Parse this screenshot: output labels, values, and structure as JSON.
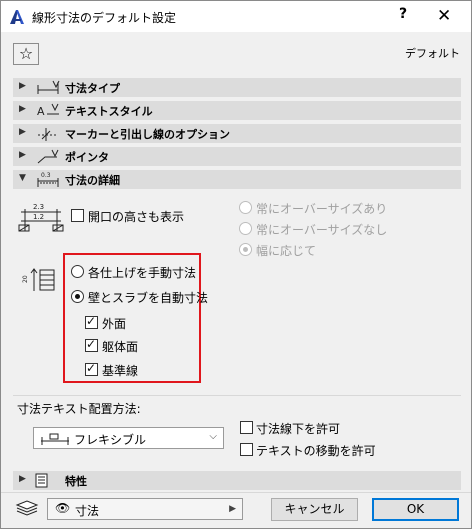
{
  "window": {
    "title": "線形寸法のデフォルト設定",
    "help_label": "?",
    "close_label": "✕"
  },
  "header": {
    "favorite_icon": "☆",
    "default_label": "デフォルト"
  },
  "sections": {
    "dim_type": "寸法タイプ",
    "text_style": "テキストスタイル",
    "marker": "マーカーと引出し線のオプション",
    "pointer": "ポインタ",
    "dim_detail": "寸法の詳細",
    "properties": "特性"
  },
  "details": {
    "icon_top_text": "2.3",
    "icon_bottom_text": "1.2",
    "icon_side_text": "20",
    "show_opening_height": "開口の高さも表示",
    "show_opening_height_checked": false,
    "oversize_options": [
      {
        "label": "常にオーバーサイズあり",
        "checked": false
      },
      {
        "label": "常にオーバーサイズなし",
        "checked": false
      },
      {
        "label": "幅に応じて",
        "checked": true
      }
    ],
    "finish_manual": "各仕上げを手動寸法",
    "wall_slab_auto": "壁とスラブを自動寸法",
    "outer_face": "外面",
    "core_face": "躯体面",
    "reference_line": "基準線"
  },
  "placement": {
    "heading": "寸法テキスト配置方法:",
    "selected": "フレキシブル",
    "allow_below": "寸法線下を許可",
    "allow_move": "テキストの移動を許可"
  },
  "footer": {
    "layer_value": "寸法",
    "cancel_label": "キャンセル",
    "ok_label": "OK"
  },
  "colors": {
    "highlight_border": "#e0161c",
    "section_bar": "#dcdcdc",
    "primary_border": "#0078d7"
  }
}
